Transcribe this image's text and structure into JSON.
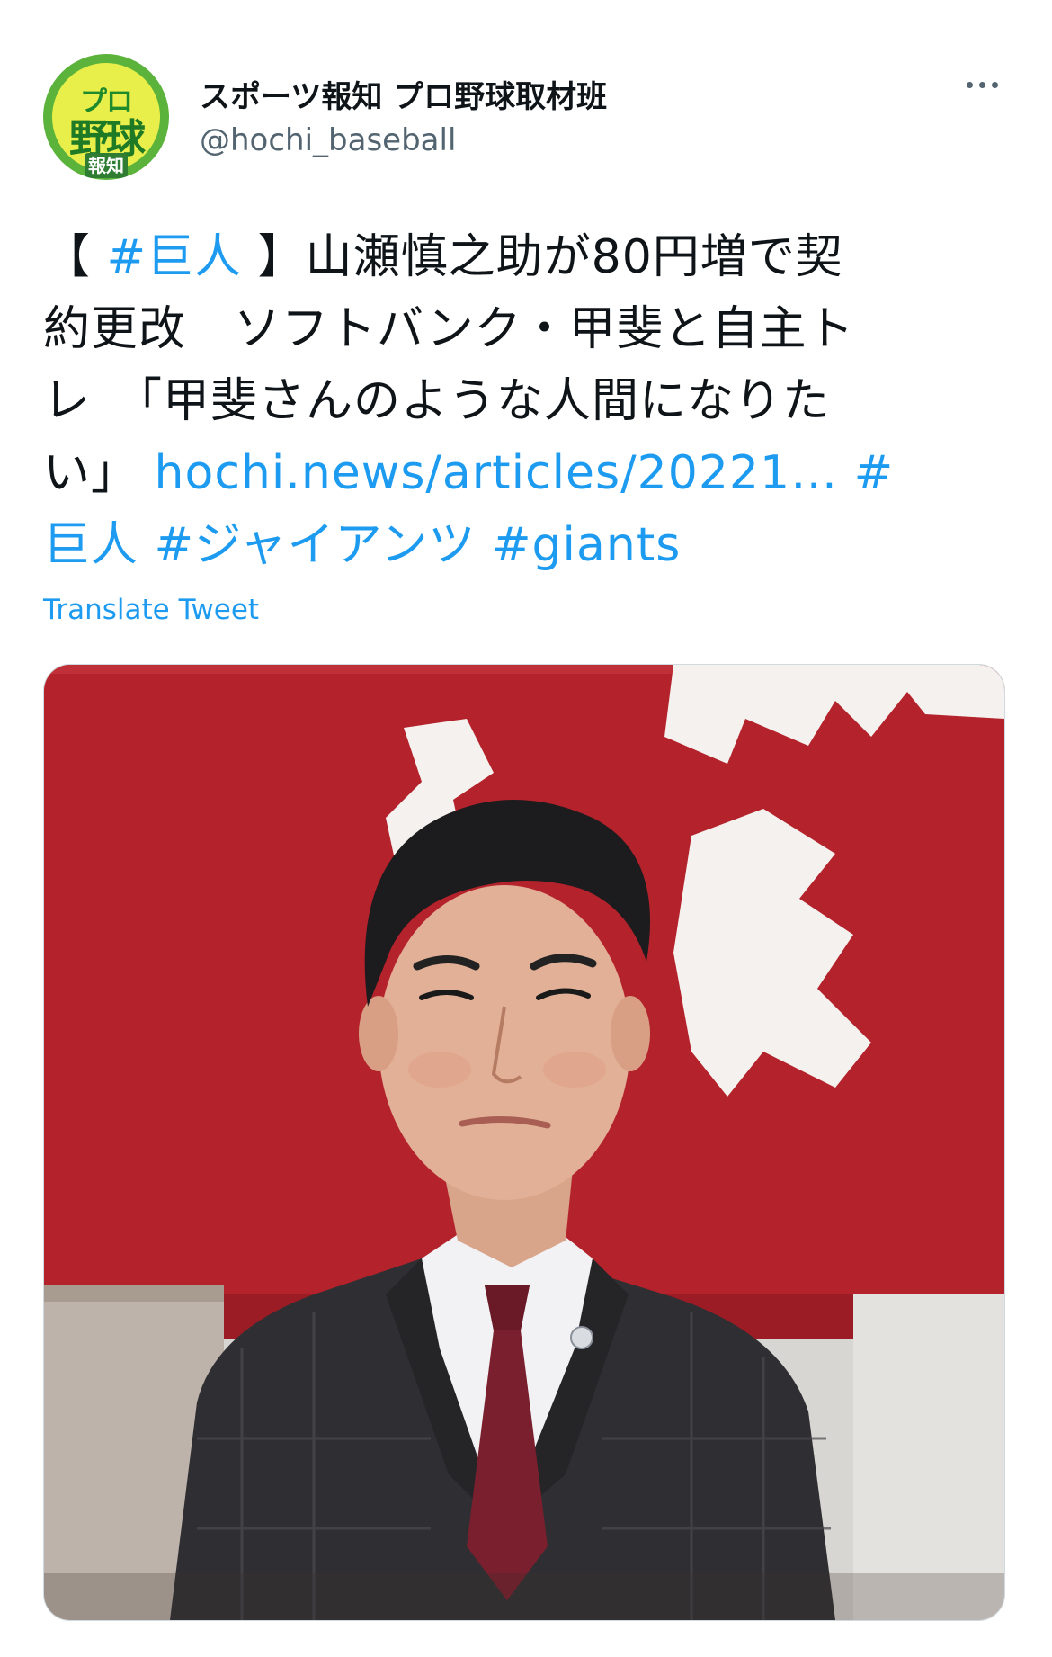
{
  "account": {
    "display_name": "スポーツ報知 プロ野球取材班",
    "handle": "@hochi_baseball",
    "avatar": {
      "line1": "プロ",
      "line2": "野球",
      "line3": "報知"
    }
  },
  "tweet": {
    "line1": {
      "open": "【 ",
      "tag": "#巨人",
      "rest": " 】山瀬慎之助が80円増で契"
    },
    "line2": "約更改　ソフトバンク・甲斐と自主ト",
    "line3": "レ　「甲斐さんのような人間になりた",
    "line4": {
      "text": "い」",
      "link": "hochi.news/articles/20221…",
      "tag": "#"
    },
    "line5": {
      "tag1": "巨人",
      "tag2": "#ジャイアンツ",
      "tag3": "#giants"
    }
  },
  "translate_label": "Translate Tweet",
  "icons": {
    "more": "more-horizontal-icon"
  },
  "colors": {
    "link": "#1d9bf0",
    "text": "#0f1419",
    "secondary": "#536471",
    "banner_red": "#b4222b"
  }
}
